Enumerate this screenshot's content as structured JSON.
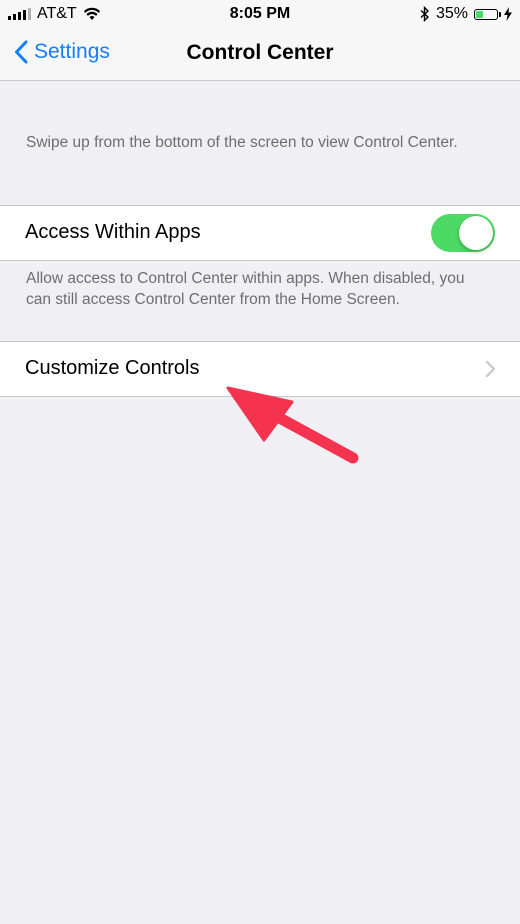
{
  "status_bar": {
    "carrier": "AT&T",
    "time": "8:05 PM",
    "battery_percent": "35%",
    "battery_level": 0.35
  },
  "nav": {
    "back_label": "Settings",
    "title": "Control Center"
  },
  "main": {
    "description": "Swipe up from the bottom of the screen to view Control Center.",
    "access_within_apps": {
      "label": "Access Within Apps",
      "enabled": true
    },
    "access_footer": "Allow access to Control Center within apps. When disabled, you can still access Control Center from the Home Screen.",
    "customize_controls": {
      "label": "Customize Controls"
    }
  },
  "colors": {
    "accent": "#157efb",
    "toggle_on": "#4cd964",
    "annotation_arrow": "#f5334f",
    "background": "#efeff4"
  }
}
